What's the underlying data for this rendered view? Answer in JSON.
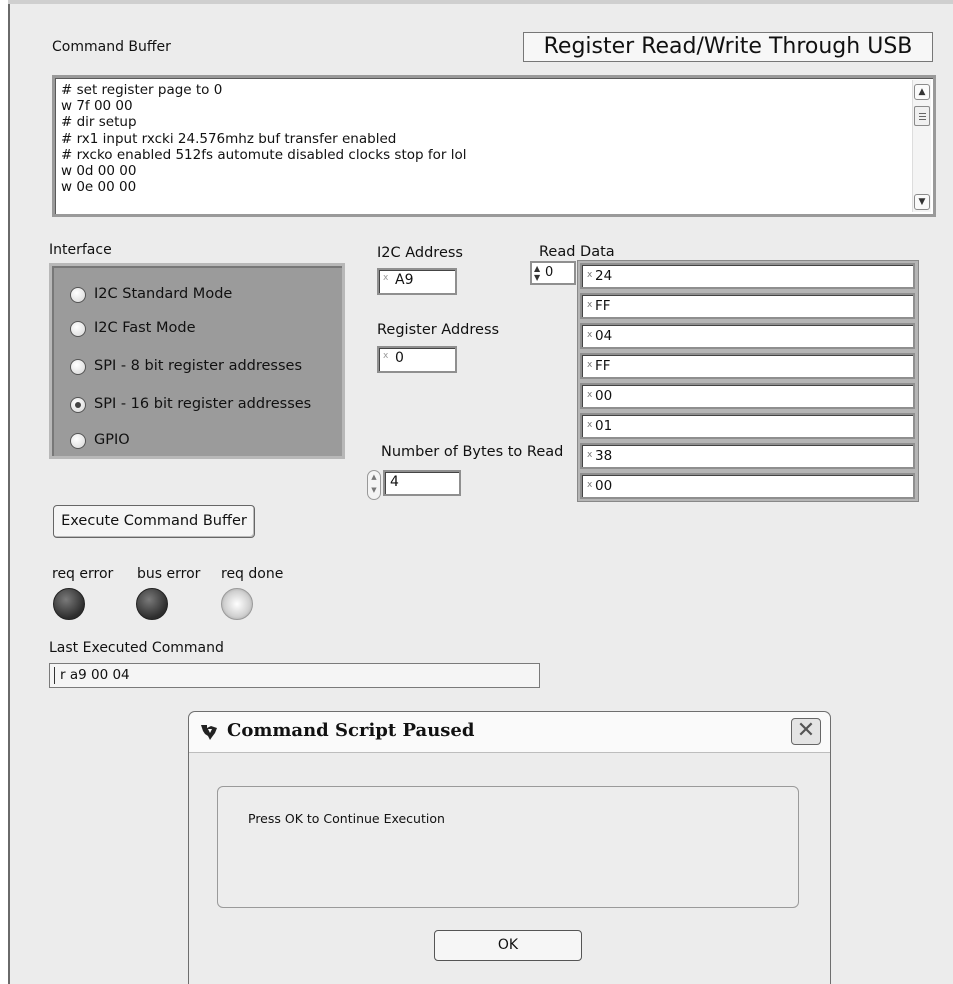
{
  "title": "Register Read/Write Through USB",
  "command_buffer": {
    "label": "Command Buffer",
    "lines": [
      "# set register page to 0",
      "w 7f 00 00",
      "# dir setup",
      "# rx1 input rxcki 24.576mhz buf transfer enabled",
      "# rxcko enabled 512fs automute disabled clocks stop for lol",
      "w 0d 00 00",
      "w 0e 00 00"
    ]
  },
  "interface": {
    "label": "Interface",
    "options": [
      {
        "label": "I2C Standard Mode",
        "selected": false
      },
      {
        "label": "I2C Fast Mode",
        "selected": false
      },
      {
        "label": "SPI - 8 bit register addresses",
        "selected": false
      },
      {
        "label": "SPI - 16 bit register addresses",
        "selected": true
      },
      {
        "label": "GPIO",
        "selected": false
      }
    ]
  },
  "i2c_address": {
    "label": "I2C Address",
    "value": "A9"
  },
  "register_address": {
    "label": "Register Address",
    "value": "0"
  },
  "bytes_to_read": {
    "label": "Number of Bytes to Read",
    "value": "4"
  },
  "read_data": {
    "label": "Read Data",
    "index": "0",
    "values": [
      "24",
      "FF",
      "04",
      "FF",
      "00",
      "01",
      "38",
      "00"
    ]
  },
  "execute_button": {
    "label": "Execute Command Buffer"
  },
  "indicators": [
    {
      "label": "req error",
      "state": "off"
    },
    {
      "label": "bus error",
      "state": "off"
    },
    {
      "label": "req done",
      "state": "on"
    }
  ],
  "last_command": {
    "label": "Last Executed Command",
    "value": "r a9 00 04"
  },
  "dialog": {
    "title": "Command Script Paused",
    "message": "Press OK to Continue Execution",
    "ok_label": "OK",
    "close_glyph": "✕"
  }
}
